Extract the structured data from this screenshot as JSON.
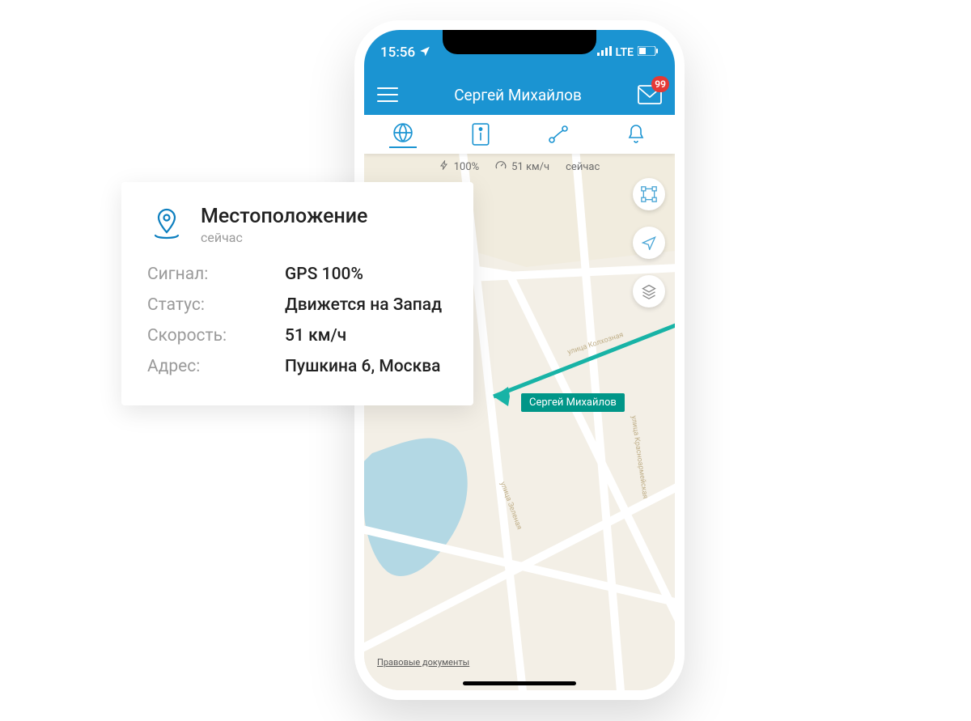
{
  "statusbar": {
    "time": "15:56",
    "network": "LTE"
  },
  "header": {
    "title": "Сергей Михайлов",
    "badge": "99"
  },
  "mapstatus": {
    "battery": "100%",
    "speed": "51 км/ч",
    "time": "сейчас"
  },
  "map": {
    "person_label": "Сергей Михайлов",
    "legal": "Правовые документы",
    "streets": {
      "kolhoz": "улица Колхозная",
      "zelen": "улица Зеленая",
      "krasno": "улица Красноармейская"
    }
  },
  "card": {
    "title": "Местоположение",
    "subtitle": "сейчас",
    "rows": {
      "signal_k": "Сигнал:",
      "signal_v": "GPS 100%",
      "status_k": "Статус:",
      "status_v": "Движется на Запад",
      "speed_k": "Скорость:",
      "speed_v": "51 км/ч",
      "addr_k": "Адрес:",
      "addr_v": "Пушкина 6, Москва"
    }
  }
}
